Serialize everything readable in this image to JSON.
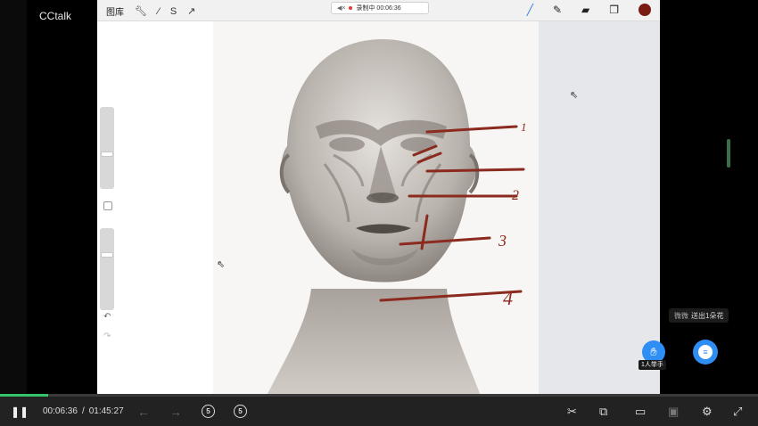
{
  "app": {
    "title": "CCtalk"
  },
  "procreate_toolbar": {
    "gallery_label": "图库",
    "tools_left": [
      "wrench-icon",
      "magic-wand-icon",
      "selection-icon",
      "transform-arrow-icon"
    ],
    "recording_status": "录制中 00:06:36",
    "tools_right": [
      "brush-icon",
      "smudge-icon",
      "eraser-icon",
      "layers-icon"
    ],
    "current_color": "#7a1c14"
  },
  "drawing": {
    "annotation_numbers": [
      "1",
      "2",
      "3",
      "4"
    ],
    "annotation_color": "#8b2a1f"
  },
  "overlay": {
    "gift_tip": {
      "user": "微微",
      "message": "送出1朵花"
    },
    "hand_raise_label": "1人举手"
  },
  "player": {
    "progress_fraction": 0.0634,
    "progress_color": "#35c46b",
    "current_time": "00:06:36",
    "separator": "/",
    "total_time": "01:45:27",
    "rewind_label": "5",
    "forward_label": "5"
  }
}
